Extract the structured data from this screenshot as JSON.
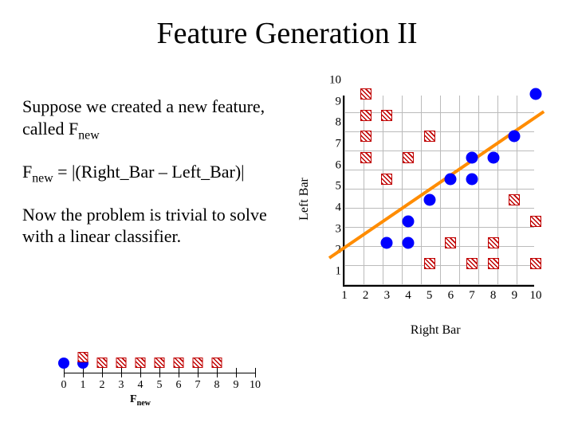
{
  "title": "Feature Generation II",
  "paragraphs": {
    "p1a": "Suppose we created a new feature, called F",
    "p1b": "new",
    "p2a": "F",
    "p2b": "new",
    "p2c": " = |(Right_Bar – Left_Bar)|",
    "p3": "Now the problem is trivial to solve with a linear classifier."
  },
  "chart_data": {
    "type": "scatter",
    "xlabel": "Right Bar",
    "ylabel": "Left Bar",
    "xlim": [
      1,
      10
    ],
    "ylim": [
      1,
      10
    ],
    "xticks": [
      1,
      2,
      3,
      4,
      5,
      6,
      7,
      8,
      9,
      10
    ],
    "yticks": [
      1,
      2,
      3,
      4,
      5,
      6,
      7,
      8,
      9,
      10
    ],
    "series": [
      {
        "name": "class-circle",
        "marker": "circle",
        "color": "#0000ff",
        "points": [
          {
            "x": 3,
            "y": 3
          },
          {
            "x": 4,
            "y": 3
          },
          {
            "x": 4,
            "y": 4
          },
          {
            "x": 5,
            "y": 5
          },
          {
            "x": 6,
            "y": 6
          },
          {
            "x": 7,
            "y": 6
          },
          {
            "x": 7,
            "y": 7
          },
          {
            "x": 8,
            "y": 7
          },
          {
            "x": 9,
            "y": 8
          },
          {
            "x": 10,
            "y": 10
          }
        ]
      },
      {
        "name": "class-hatch",
        "marker": "hatch",
        "color": "#c00000",
        "points": [
          {
            "x": 2,
            "y": 7
          },
          {
            "x": 2,
            "y": 8
          },
          {
            "x": 2,
            "y": 9
          },
          {
            "x": 2,
            "y": 10
          },
          {
            "x": 3,
            "y": 6
          },
          {
            "x": 3,
            "y": 9
          },
          {
            "x": 4,
            "y": 7
          },
          {
            "x": 5,
            "y": 2
          },
          {
            "x": 5,
            "y": 8
          },
          {
            "x": 6,
            "y": 3
          },
          {
            "x": 7,
            "y": 2
          },
          {
            "x": 8,
            "y": 2
          },
          {
            "x": 8,
            "y": 3
          },
          {
            "x": 9,
            "y": 5
          },
          {
            "x": 10,
            "y": 2
          },
          {
            "x": 10,
            "y": 4
          }
        ]
      }
    ],
    "decision_line": {
      "x1": 0.3,
      "y1": 2.2,
      "x2": 10.4,
      "y2": 9.1
    }
  },
  "numberline": {
    "label": "F",
    "label_sub": "new",
    "ticks": [
      0,
      1,
      2,
      3,
      4,
      5,
      6,
      7,
      8,
      9,
      10
    ],
    "points": [
      {
        "x": 0,
        "class": "circle"
      },
      {
        "x": 1,
        "class": "circle"
      },
      {
        "x": 1,
        "class": "hatch"
      },
      {
        "x": 2,
        "class": "hatch"
      },
      {
        "x": 3,
        "class": "hatch"
      },
      {
        "x": 4,
        "class": "hatch"
      },
      {
        "x": 5,
        "class": "hatch"
      },
      {
        "x": 6,
        "class": "hatch"
      },
      {
        "x": 7,
        "class": "hatch"
      },
      {
        "x": 8,
        "class": "hatch"
      }
    ]
  }
}
